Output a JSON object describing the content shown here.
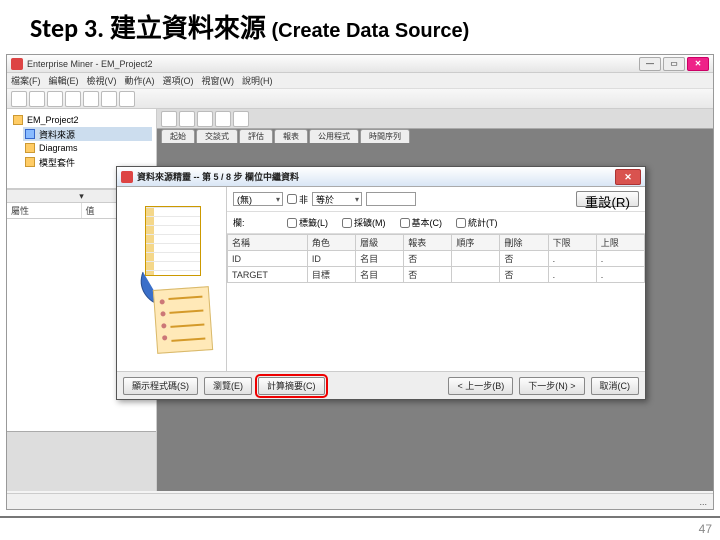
{
  "slide": {
    "step": "Step 3. ",
    "zh": "建立資料來源",
    "en": " (Create Data Source)",
    "page_num": "47"
  },
  "app": {
    "title": "Enterprise Miner - EM_Project2",
    "menu": [
      "檔案(F)",
      "編輯(E)",
      "檢視(V)",
      "動作(A)",
      "選項(O)",
      "視窗(W)",
      "說明(H)"
    ],
    "tree": {
      "root": "EM_Project2",
      "items": [
        "資料來源",
        "Diagrams",
        "模型套件"
      ]
    },
    "prop": {
      "col1": "屬性",
      "col2": "值"
    },
    "canvas_tabs": [
      "起始",
      "交談式",
      "評估",
      "報表",
      "公用程式",
      "時間序列"
    ],
    "status_right": "..."
  },
  "dialog": {
    "title": "資料來源精靈 -- 第 5 / 8 步 欄位中繼資料",
    "filter": {
      "combo1": "(無)",
      "not_label": "非",
      "combo2": "等於",
      "reset_btn": "重設(R)"
    },
    "checks": {
      "label": "標籤(L)",
      "mining": "採礦(M)",
      "basic": "基本(C)",
      "stats": "統計(T)"
    },
    "columns": [
      "名稱",
      "角色",
      "層級",
      "報表",
      "順序",
      "刪除",
      "下限",
      "上限"
    ],
    "rows": [
      {
        "name": "ID",
        "role": "ID",
        "level": "名目",
        "report": "否",
        "order": "",
        "drop": "否",
        "low": ".",
        "high": "."
      },
      {
        "name": "TARGET",
        "role": "目標",
        "level": "名目",
        "report": "否",
        "order": "",
        "drop": "否",
        "low": ".",
        "high": "."
      }
    ],
    "footer": {
      "show_code": "顯示程式碼(S)",
      "explore": "瀏覽(E)",
      "compute": "計算摘要(C)",
      "back": "< 上一步(B)",
      "next": "下一步(N) >",
      "cancel": "取消(C)"
    }
  }
}
